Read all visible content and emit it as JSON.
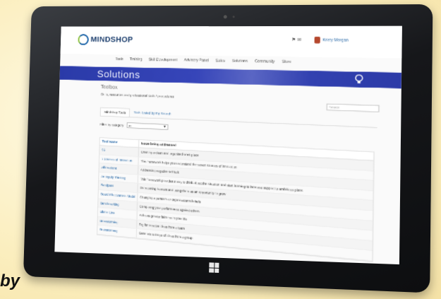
{
  "brand": {
    "name": "MINDSHOP"
  },
  "header": {
    "user_name": "Kristy Morgan",
    "flag": "⚑ ✉"
  },
  "nav": {
    "items": [
      "Tools",
      "Training",
      "Skill Development",
      "Advisory Panel",
      "Sales",
      "Solutions",
      "Community",
      "Store"
    ]
  },
  "banner": {
    "title": "Solutions"
  },
  "page": {
    "section_title": "Toolbox",
    "intro": "Skills, resources and professional tools / procedures",
    "search_placeholder": "Search"
  },
  "tabs": {
    "items": [
      "Mindshop Tools",
      "Tools Listed by my Search"
    ]
  },
  "filter": {
    "label": "Filter by category",
    "value": "All"
  },
  "table": {
    "headers": [
      "Tool Name",
      "Issue being addressed"
    ],
    "rows": [
      {
        "name": "5S",
        "issue": "Creating a clean and organised work place"
      },
      {
        "name": "7 Sources of Innovation",
        "issue": "This framework helps you understand the seven sources of innovation"
      },
      {
        "name": "Affirmations",
        "issue": "Addressing negative self talk"
      },
      {
        "name": "Ambiguity Thinking",
        "issue": "This framework provides a way to think about the situation and start learning to increase support to ambitious plans"
      },
      {
        "name": "Bandpass",
        "issue": "Overcoming barriers and using them as an opportunity to grow"
      },
      {
        "name": "Board Effectiveness Model",
        "issue": "Changing a person's or organisation's beliefs"
      },
      {
        "name": "Benchmarking",
        "issue": "Comparing your performance against others"
      },
      {
        "name": "Blame Line",
        "issue": "Achieve greater fairness in your life"
      },
      {
        "name": "Brainstorming",
        "issue": "Dig for creative ideas from a team"
      },
      {
        "name": "Brainstorming",
        "issue": "Generate a range of ideas from a group"
      }
    ]
  },
  "caption": {
    "text": "by"
  },
  "colors": {
    "banner": "#3240b3",
    "link": "#2a6aa8",
    "background": "#fdf3cf"
  }
}
